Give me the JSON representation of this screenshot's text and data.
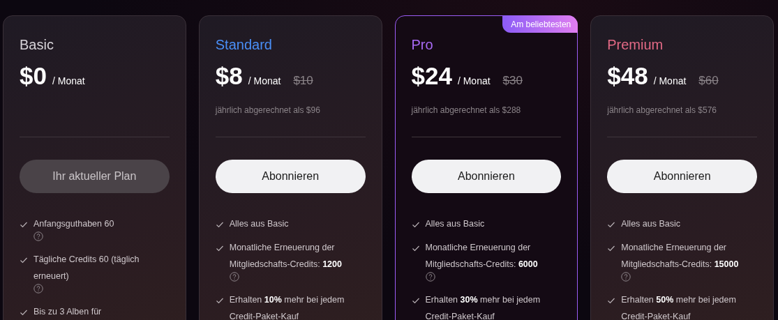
{
  "plans": [
    {
      "name": "Basic",
      "color": "#d6d3d8",
      "price": "$0",
      "period": "/ Monat",
      "current": true,
      "highlighted": false,
      "button": "Ihr aktueller Plan",
      "features": [
        {
          "text": "Anfangsguthaben 60",
          "help": true
        },
        {
          "text": "Tägliche Credits 60 (täglich erneuert)",
          "help": true
        },
        {
          "text": "Bis zu 3 Alben für",
          "help": false
        }
      ]
    },
    {
      "name": "Standard",
      "color": "#4a8ff7",
      "price": "$8",
      "period": "/ Monat",
      "old_price": "$10",
      "billed": "jährlich abgerechnet als $96",
      "current": false,
      "highlighted": false,
      "button": "Abonnieren",
      "features": [
        {
          "text": "Alles aus Basic",
          "help": false
        },
        {
          "text": "Monatliche Erneuerung der Mitgliedschafts-Credits: **1200**",
          "help": true
        },
        {
          "text": "Erhalten **10%** mehr bei jedem Credit-Paket-Kauf",
          "help": false
        }
      ]
    },
    {
      "name": "Pro",
      "color": "#a86af5",
      "price": "$24",
      "period": "/ Monat",
      "old_price": "$30",
      "billed": "jährlich abgerechnet als $288",
      "current": false,
      "highlighted": true,
      "badge": "Am beliebtesten",
      "button": "Abonnieren",
      "features": [
        {
          "text": "Alles aus Basic",
          "help": false
        },
        {
          "text": "Monatliche Erneuerung der Mitgliedschafts-Credits: **6000**",
          "help": true
        },
        {
          "text": "Erhalten **30%** mehr bei jedem Credit-Paket-Kauf",
          "help": false
        }
      ]
    },
    {
      "name": "Premium",
      "color": "#e46a86",
      "price": "$48",
      "period": "/ Monat",
      "old_price": "$60",
      "billed": "jährlich abgerechnet als $576",
      "current": false,
      "highlighted": false,
      "button": "Abonnieren",
      "features": [
        {
          "text": "Alles aus Basic",
          "help": false
        },
        {
          "text": "Monatliche Erneuerung der Mitgliedschafts-Credits: **15000**",
          "help": true
        },
        {
          "text": "Erhalten **50%** mehr bei jedem Credit-Paket-Kauf",
          "help": false
        }
      ]
    }
  ]
}
